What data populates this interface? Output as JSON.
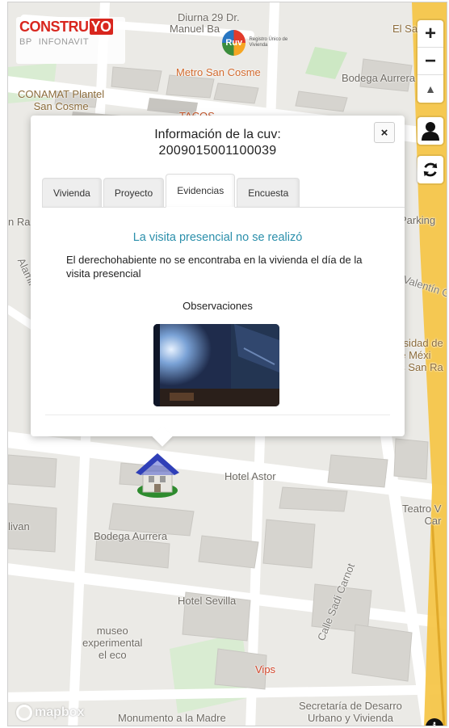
{
  "brand": {
    "logo_main": "CONSTRU",
    "logo_yo": "YO",
    "logo_sub_left": "BP",
    "logo_sub_right": "INFONAVIT",
    "ruv_label": "Ruv",
    "ruv_text": "Registro Único de Vivienda"
  },
  "map": {
    "labels": {
      "top_line1": "Diurna 29 Dr.",
      "top_line2": "Manuel Ba",
      "el_sa": "El Sa",
      "metro": "Metro San Cosme",
      "bodega_top": "Bodega Aurrera",
      "conamat": "CONAMAT Plantel\nSan Cosme",
      "tacos": "TACOS",
      "n_ra": "n Ra",
      "parking": "Parking",
      "alamira": "Alamira",
      "valentin": "Valentín G",
      "univ": "ersidad de\nde Méxi\nus San Ra",
      "hotel_astor": "Hotel Astor",
      "livan": "livan",
      "teatro": "Teatro V\nCar",
      "bodega_mid": "Bodega Aurrera",
      "calle_sadi": "Calle Sadi Carnot",
      "hotel_sevilla": "Hotel Sevilla",
      "museo": "museo\nexperimental\nel eco",
      "vips": "Vips",
      "secretaria": "Secretaría de Desarro\nUrbano y Vivienda",
      "monumento": "Monumento a la Madre"
    },
    "attribution": "mapbox",
    "info_icon": "i"
  },
  "controls": {
    "zoom_in": "+",
    "zoom_out": "−",
    "compass": "▲",
    "user_icon": "person-icon",
    "refresh_icon": "refresh-icon"
  },
  "modal": {
    "title": "Información de la cuv:",
    "cuv": "2009015001100039",
    "close_label": "×",
    "tabs": [
      {
        "label": "Vivienda",
        "active": false
      },
      {
        "label": "Proyecto",
        "active": false
      },
      {
        "label": "Evidencias",
        "active": true
      },
      {
        "label": "Encuesta",
        "active": false
      }
    ],
    "status": "La visita presencial no se realizó",
    "description": "El derechohabiente no se encontraba en la vivienda el día de la visita presencial",
    "observations_title": "Observaciones",
    "colors": {
      "status": "#2b8fab",
      "marker_roof": "#2f3fb8",
      "marker_base": "#2e8b2e"
    }
  }
}
